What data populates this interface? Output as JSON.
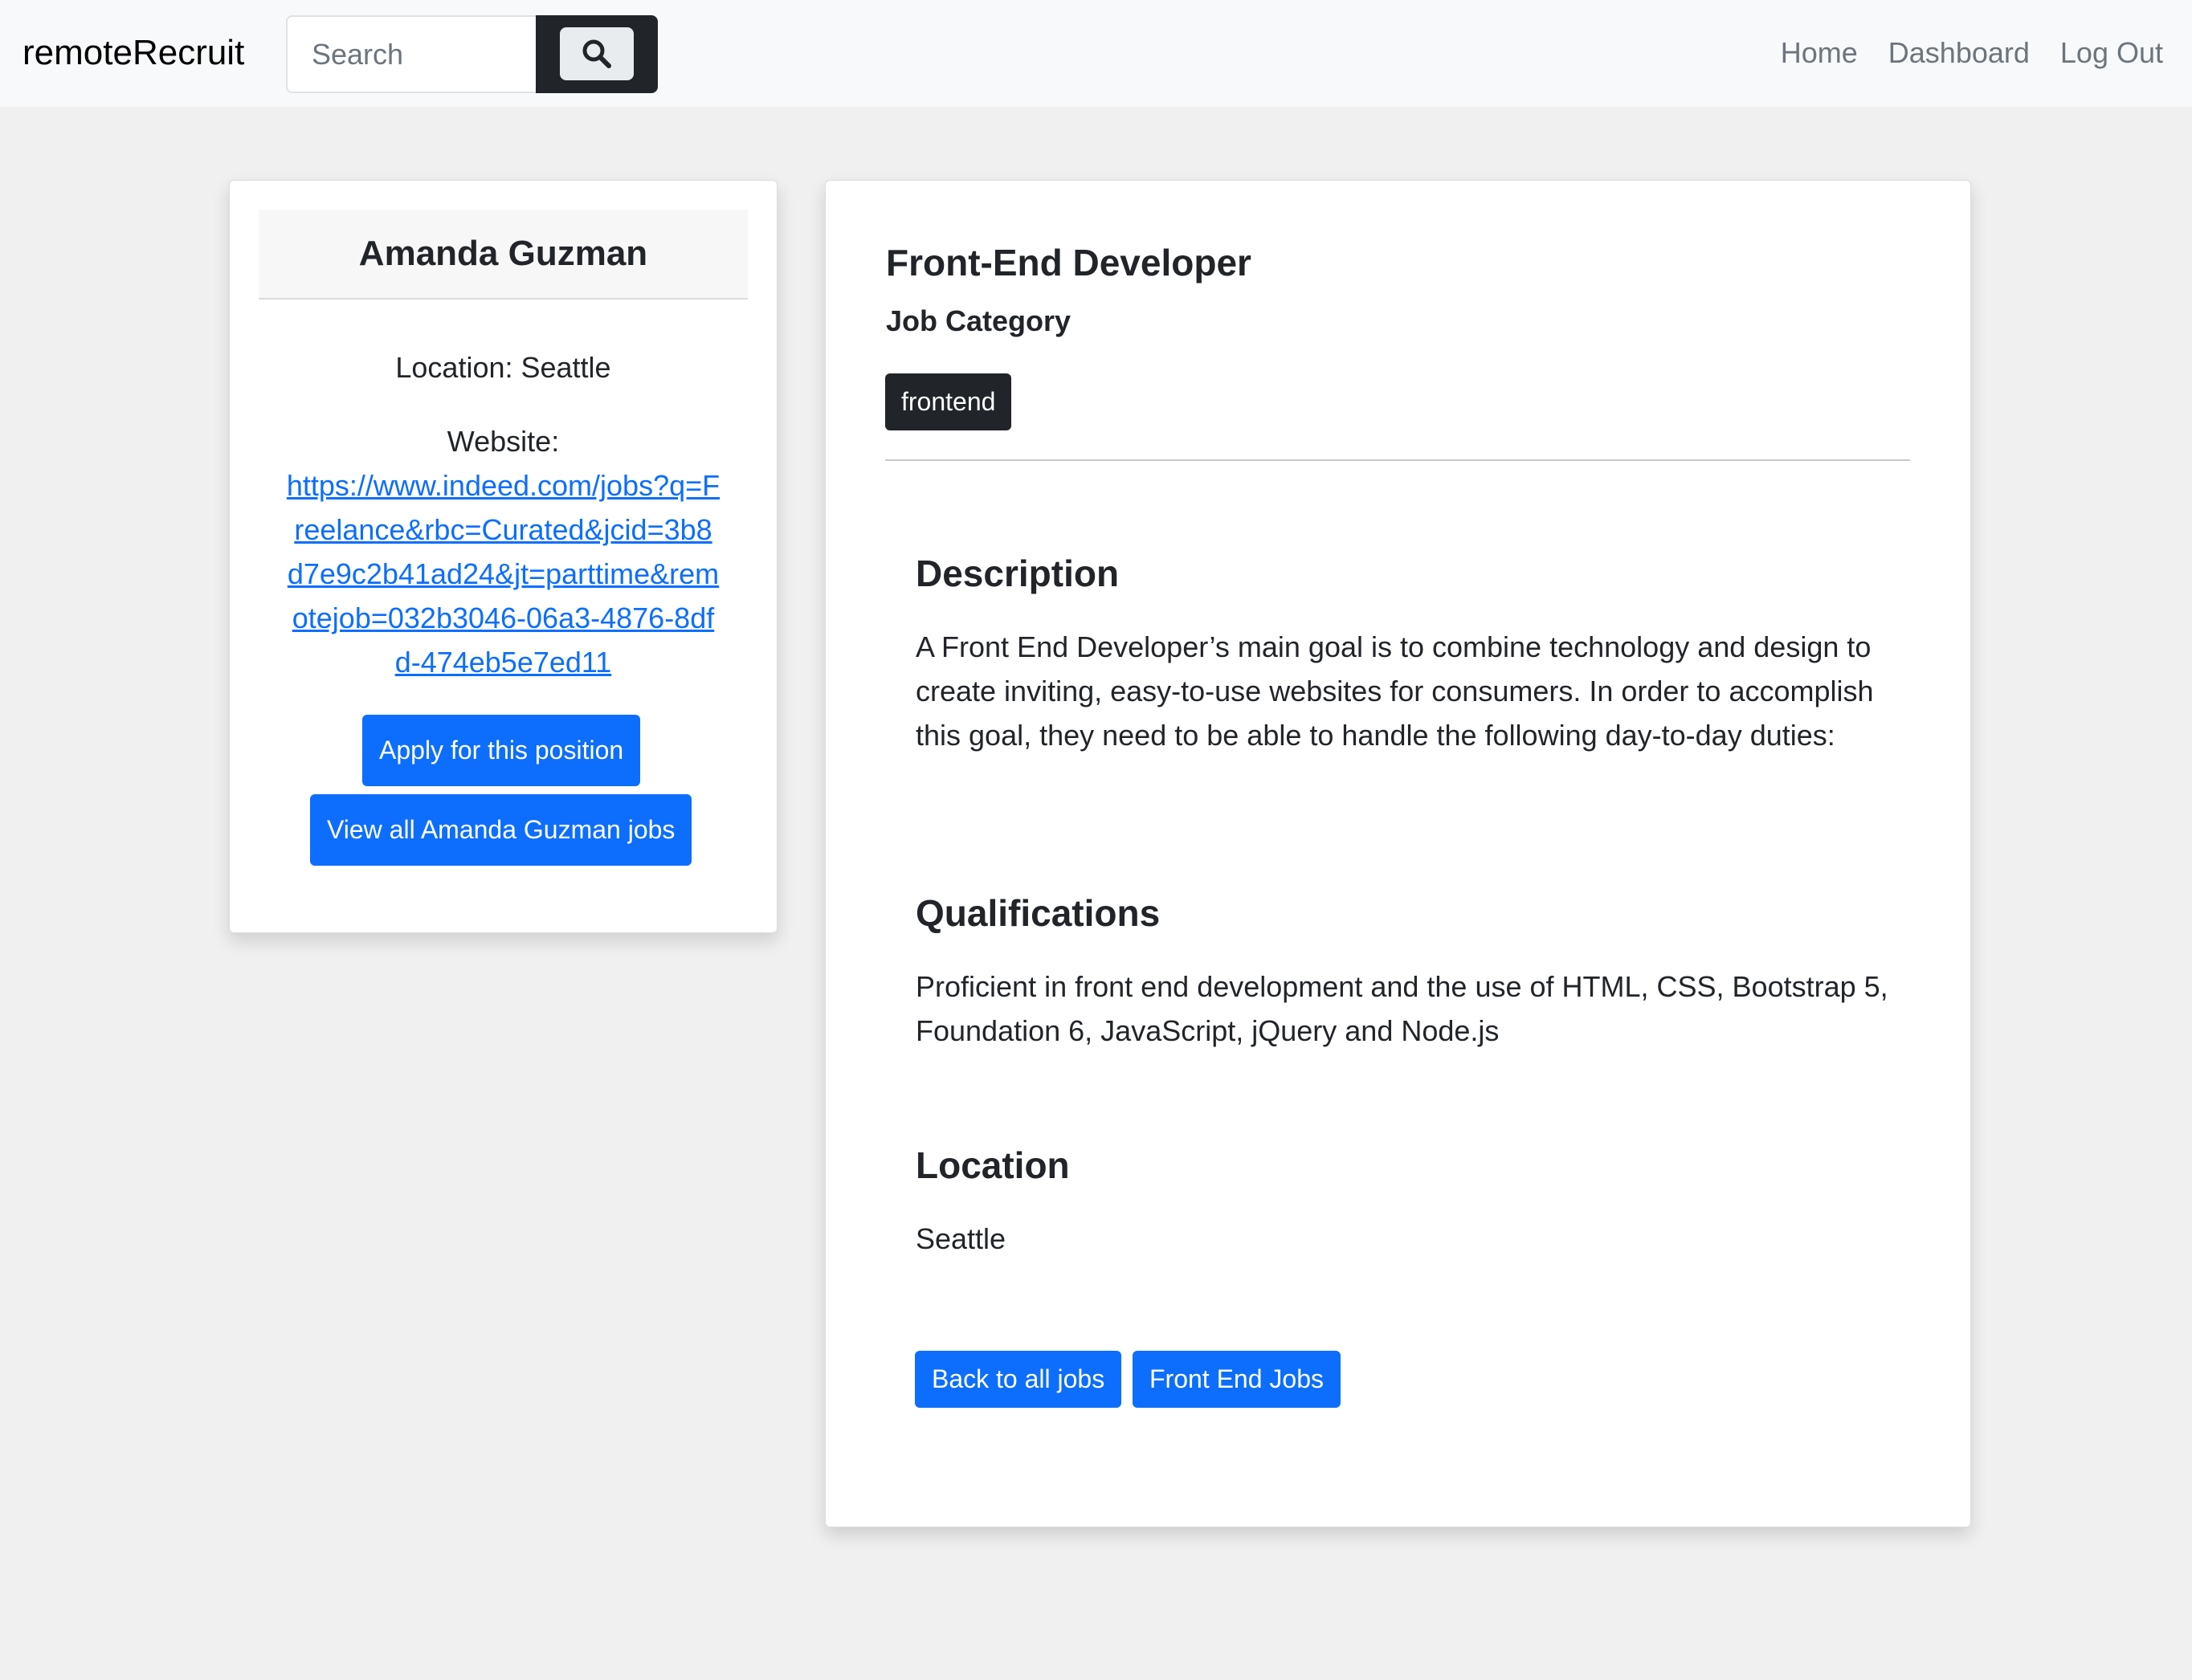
{
  "navbar": {
    "brand": "remoteRecruit",
    "search_placeholder": "Search",
    "links": [
      "Home",
      "Dashboard",
      "Log Out"
    ]
  },
  "employer": {
    "name": "Amanda Guzman",
    "location": "Location: Seattle",
    "website_label": "Website:",
    "website_url": "https://www.indeed.com/jobs?q=Freelance&rbc=Curated&jcid=3b8d7e9c2b41ad24&jt=parttime&remotejob=032b3046-06a3-4876-8dfd-474eb5e7ed11",
    "apply_button": "Apply for this position",
    "view_jobs_button": "View all Amanda Guzman jobs"
  },
  "job": {
    "title": "Front-End Developer",
    "category_label": "Job Category",
    "category": "frontend",
    "description_heading": "Description",
    "description": "A Front End Developer’s main goal is to combine technology and design to create inviting, easy-to-use websites for consumers. In order to accomplish this goal, they need to be able to handle the following day-to-day duties:",
    "qualifications_heading": "Qualifications",
    "qualifications": "Proficient in front end development and the use of HTML, CSS, Bootstrap 5, Foundation 6, JavaScript, jQuery and Node.js",
    "location_heading": "Location",
    "location": "Seattle",
    "back_button": "Back to all jobs",
    "category_jobs_button": "Front End Jobs"
  },
  "colors": {
    "primary": "#0d6efd",
    "dark": "#212529",
    "navbar_bg": "#f8f9fa",
    "page_bg": "#f0f0f0"
  }
}
